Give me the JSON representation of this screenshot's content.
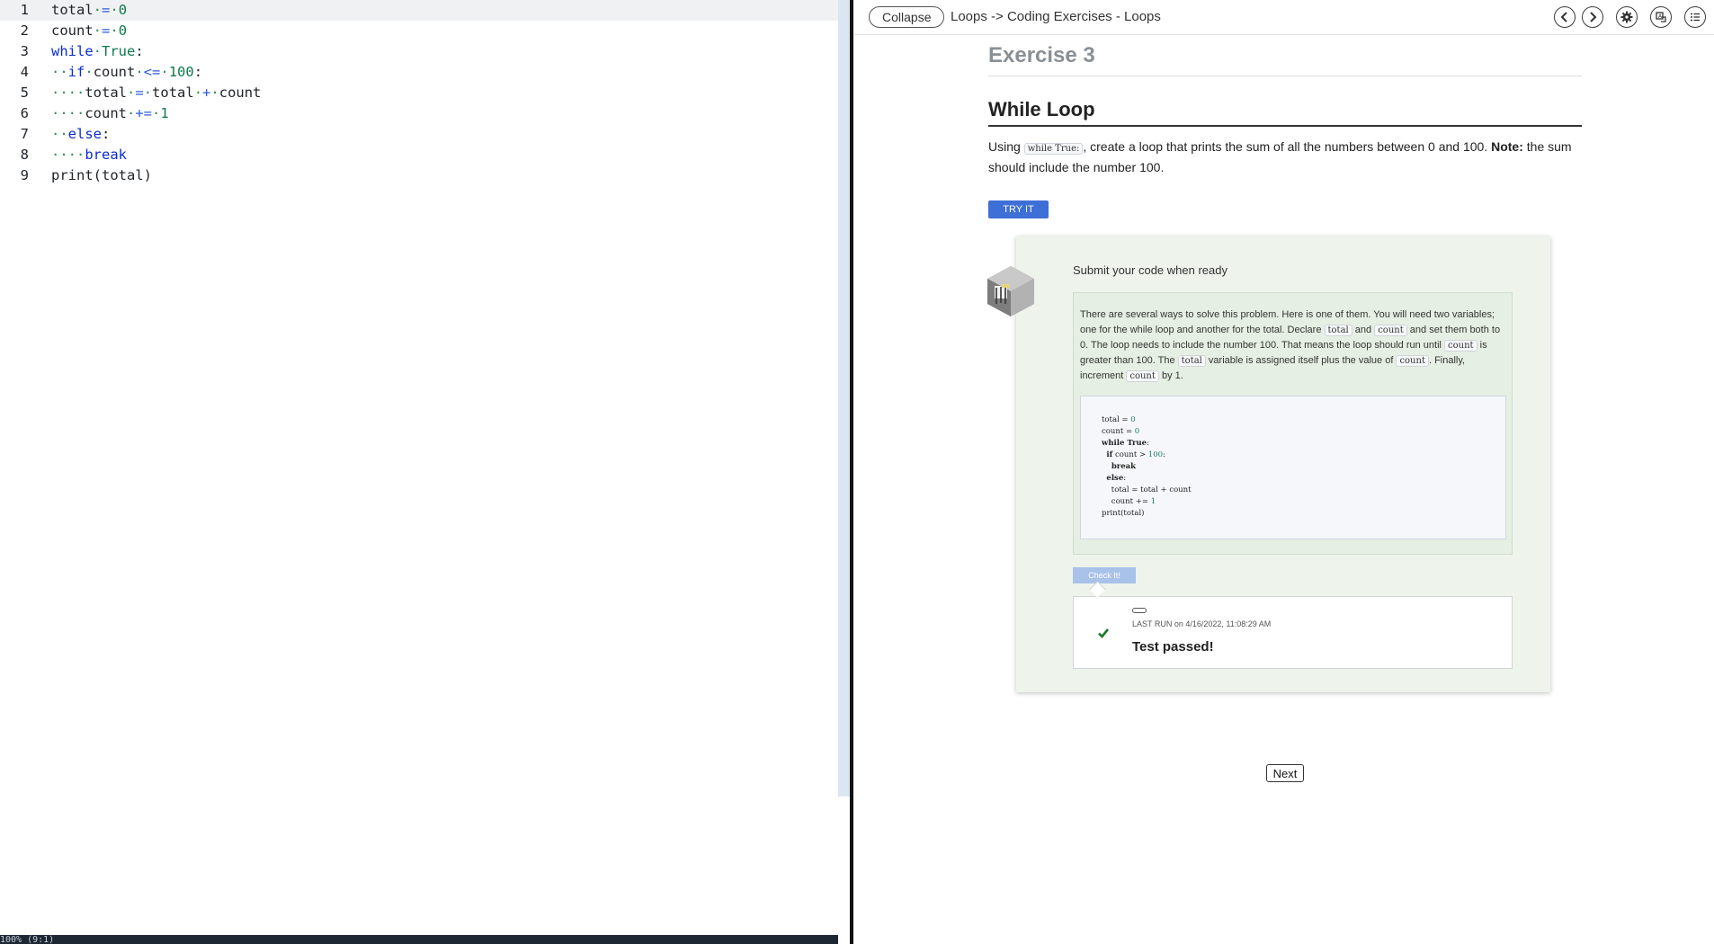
{
  "editor": {
    "lines": [
      {
        "num": "1",
        "tokens": [
          [
            "plain",
            "total"
          ],
          [
            "ws",
            "·"
          ],
          [
            "op",
            "="
          ],
          [
            "ws",
            "·"
          ],
          [
            "num",
            "0"
          ]
        ]
      },
      {
        "num": "2",
        "tokens": [
          [
            "plain",
            "count"
          ],
          [
            "ws",
            "·"
          ],
          [
            "op",
            "="
          ],
          [
            "ws",
            "·"
          ],
          [
            "num",
            "0"
          ]
        ]
      },
      {
        "num": "3",
        "tokens": [
          [
            "kw",
            "while"
          ],
          [
            "ws",
            "·"
          ],
          [
            "bool",
            "True"
          ],
          [
            "plain",
            ":"
          ]
        ]
      },
      {
        "num": "4",
        "tokens": [
          [
            "ws",
            "··"
          ],
          [
            "kw",
            "if"
          ],
          [
            "ws",
            "·"
          ],
          [
            "plain",
            "count"
          ],
          [
            "ws",
            "·"
          ],
          [
            "op",
            "<="
          ],
          [
            "ws",
            "·"
          ],
          [
            "num",
            "100"
          ],
          [
            "plain",
            ":"
          ]
        ]
      },
      {
        "num": "5",
        "tokens": [
          [
            "ws",
            "····"
          ],
          [
            "plain",
            "total"
          ],
          [
            "ws",
            "·"
          ],
          [
            "op",
            "="
          ],
          [
            "ws",
            "·"
          ],
          [
            "plain",
            "total"
          ],
          [
            "ws",
            "·"
          ],
          [
            "op",
            "+"
          ],
          [
            "ws",
            "·"
          ],
          [
            "plain",
            "count"
          ]
        ]
      },
      {
        "num": "6",
        "tokens": [
          [
            "ws",
            "····"
          ],
          [
            "plain",
            "count"
          ],
          [
            "ws",
            "·"
          ],
          [
            "op",
            "+="
          ],
          [
            "ws",
            "·"
          ],
          [
            "num",
            "1"
          ]
        ]
      },
      {
        "num": "7",
        "tokens": [
          [
            "ws",
            "··"
          ],
          [
            "kw",
            "else"
          ],
          [
            "plain",
            ":"
          ]
        ]
      },
      {
        "num": "8",
        "tokens": [
          [
            "ws",
            "····"
          ],
          [
            "kw",
            "break"
          ]
        ]
      },
      {
        "num": "9",
        "tokens": [
          [
            "plain",
            "print(total)"
          ]
        ]
      }
    ],
    "status": "100% (9:1)"
  },
  "topbar": {
    "collapse_label": "Collapse",
    "breadcrumb": "Loops -> Coding Exercises - Loops",
    "icons": [
      "chevron-left-icon",
      "chevron-right-icon",
      "gear-icon",
      "translate-icon",
      "list-icon"
    ]
  },
  "exercise": {
    "number": "Exercise 3",
    "title": "While Loop",
    "instr_pre": "Using",
    "instr_code": "while True:",
    "instr_mid": ", create a loop that prints the sum of all the numbers between 0 and 100.",
    "instr_note_label": "Note:",
    "instr_note": "the sum should include the number 100.",
    "try_it_label": "TRY IT"
  },
  "submission": {
    "prompt": "Submit your code when ready",
    "solution_parts": [
      [
        "text",
        "There are several ways to solve this problem. Here is one of them. You will need two variables; one for the while loop and another for the total. Declare "
      ],
      [
        "code",
        "total"
      ],
      [
        "text",
        " and "
      ],
      [
        "code",
        "count"
      ],
      [
        "text",
        " and set them both to 0. The loop needs to include the number 100. That means the loop should run until "
      ],
      [
        "code",
        "count"
      ],
      [
        "text",
        " is greater than 100. The "
      ],
      [
        "code",
        "total"
      ],
      [
        "text",
        " variable is assigned itself plus the value of "
      ],
      [
        "code",
        "count"
      ],
      [
        "text",
        ". Finally, increment "
      ],
      [
        "code",
        "count"
      ],
      [
        "text",
        " by 1."
      ]
    ],
    "solution_code": [
      [
        [
          "t",
          "total = "
        ],
        [
          "n",
          "0"
        ]
      ],
      [
        [
          "t",
          "count = "
        ],
        [
          "n",
          "0"
        ]
      ],
      [
        [
          "k",
          "while True"
        ],
        [
          "t",
          ":"
        ]
      ],
      [
        [
          "t",
          "  "
        ],
        [
          "k",
          "if"
        ],
        [
          "t",
          " count > "
        ],
        [
          "n",
          "100"
        ],
        [
          "t",
          ":"
        ]
      ],
      [
        [
          "t",
          "    "
        ],
        [
          "k",
          "break"
        ]
      ],
      [
        [
          "t",
          "  "
        ],
        [
          "k",
          "else"
        ],
        [
          "t",
          ":"
        ]
      ],
      [
        [
          "t",
          "    total = total + count"
        ]
      ],
      [
        [
          "t",
          "    count += "
        ],
        [
          "n",
          "1"
        ]
      ],
      [
        [
          "t",
          "print(total)"
        ]
      ]
    ],
    "check_label": "Check It!",
    "last_run_label": "LAST RUN",
    "last_run_time": "on 4/16/2022, 11:08:29 AM",
    "result": "Test passed!"
  },
  "next_label": "Next",
  "colors": {
    "accent": "#3d6fd6",
    "card_bg": "#eef3ec",
    "check": "#1a7a2a"
  }
}
